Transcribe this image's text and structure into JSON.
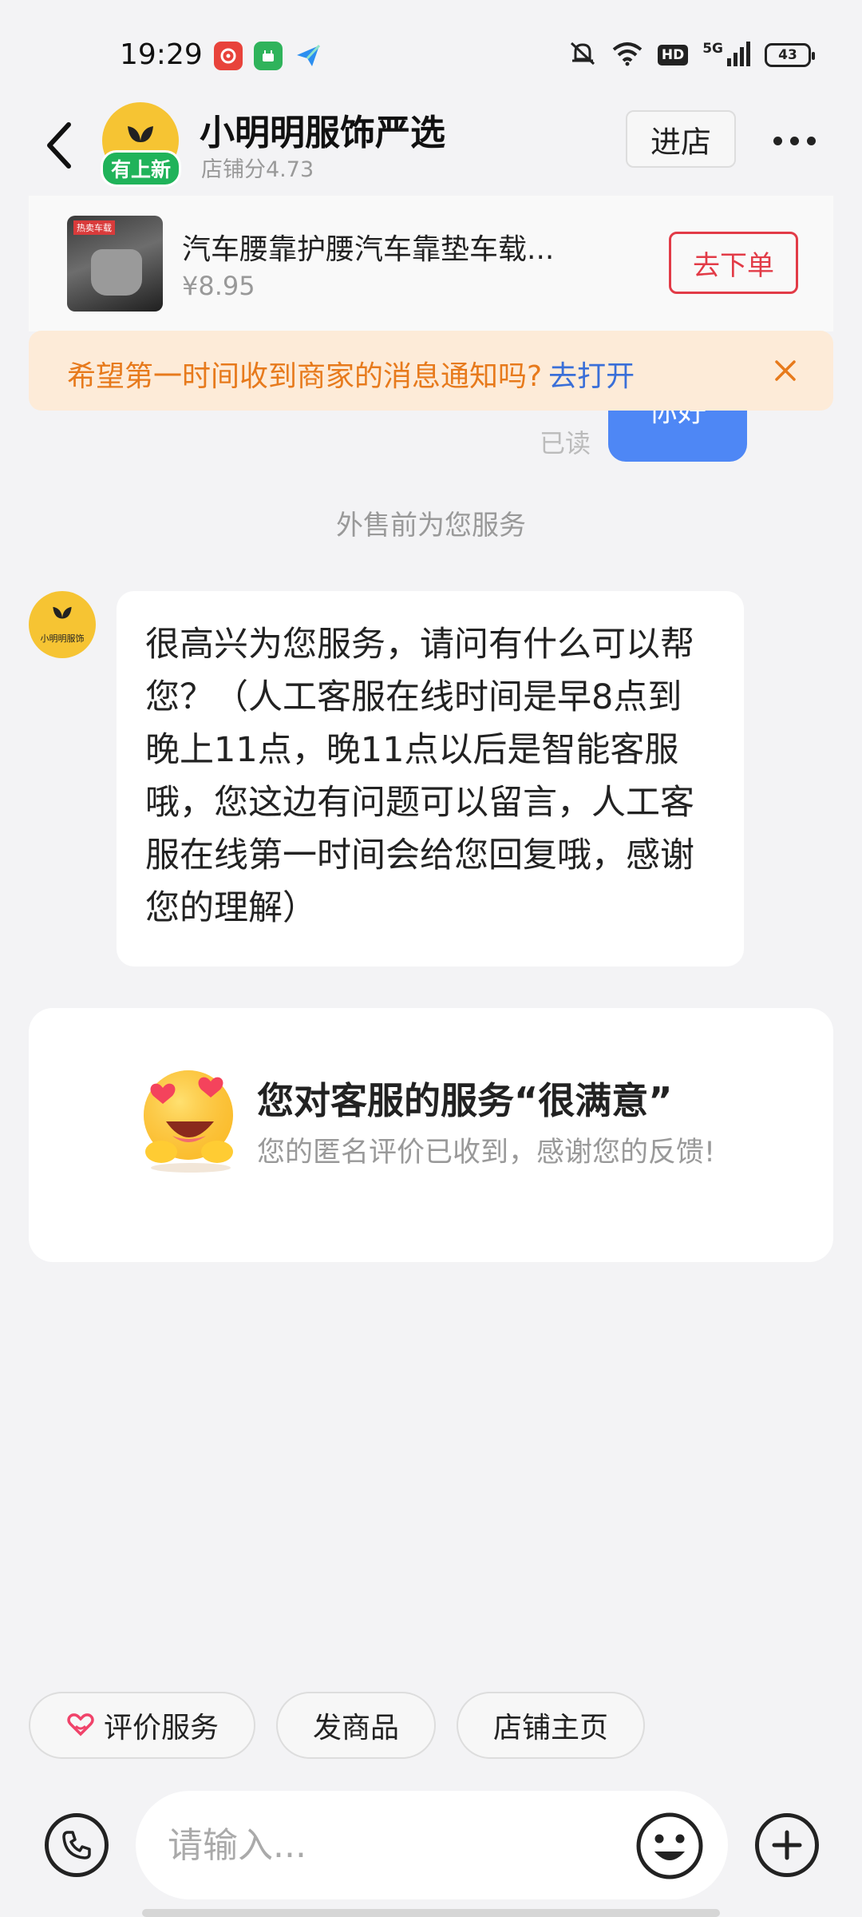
{
  "status_bar": {
    "time": "19:29",
    "battery": "43",
    "network": "5G",
    "hd": "HD",
    "app_icons": [
      "netease-music-icon",
      "green-app-icon",
      "paper-plane-icon"
    ],
    "right_icons": [
      "mute-bell-icon",
      "wifi-icon",
      "hd-icon",
      "signal-icon",
      "battery-icon"
    ]
  },
  "header": {
    "shop_name": "小明明服饰严选",
    "shop_score": "店铺分4.73",
    "new_badge": "有上新",
    "enter_label": "进店"
  },
  "product": {
    "title": "汽车腰靠护腰汽车靠垫车载...",
    "price": "¥8.95",
    "order_label": "去下单",
    "thumb_tag": "热卖车载"
  },
  "notify": {
    "text": "希望第一时间收到商家的消息通知吗?",
    "link": "去打开"
  },
  "chat": {
    "prev_message": "你好",
    "read_label": "已读",
    "system_tip": "外售前为您服务",
    "agent_avatar_label": "小明明服饰",
    "agent_message": "很高兴为您服务，请问有什么可以帮您？（人工客服在线时间是早8点到晚上11点，晚11点以后是智能客服哦，您这边有问题可以留言，人工客服在线第一时间会给您回复哦，感谢您的理解）"
  },
  "feedback": {
    "title": "您对客服的服务“很满意”",
    "subtitle": "您的匿名评价已收到，感谢您的反馈!"
  },
  "quick_actions": [
    {
      "label": "评价服务",
      "icon": "heart-hand-icon"
    },
    {
      "label": "发商品"
    },
    {
      "label": "店铺主页"
    }
  ],
  "input": {
    "placeholder": "请输入..."
  },
  "colors": {
    "accent_blue": "#4e87f5",
    "order_red": "#e23b47",
    "notify_orange": "#e77a1c",
    "badge_green": "#20b35a",
    "avatar_yellow": "#f6c433"
  }
}
